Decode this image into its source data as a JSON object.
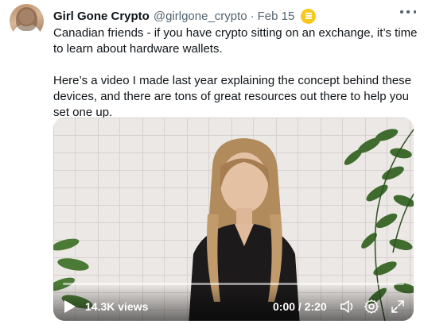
{
  "tweet": {
    "author_name": "Girl Gone Crypto",
    "handle": "@girlgone_crypto",
    "separator": "·",
    "date": "Feb 15",
    "paragraphs": [
      "Canadian friends - if you have crypto sitting on an exchange, it’s time to learn about hardware wallets.",
      "Here’s a video I made last year explaining the concept behind these devices, and there are tons of great resources out there to help you set one up."
    ]
  },
  "video": {
    "views": "14.3K views",
    "time": "0:00 / 2:20",
    "progress": 0.0
  },
  "icons": {
    "badge": "coin-badge-icon",
    "more": "more-icon",
    "play": "play-icon",
    "volume": "volume-icon",
    "settings": "gear-icon",
    "fullscreen": "fullscreen-icon"
  },
  "colors": {
    "text": "#0f1419",
    "secondary": "#536471",
    "badge": "#f8c81f"
  }
}
